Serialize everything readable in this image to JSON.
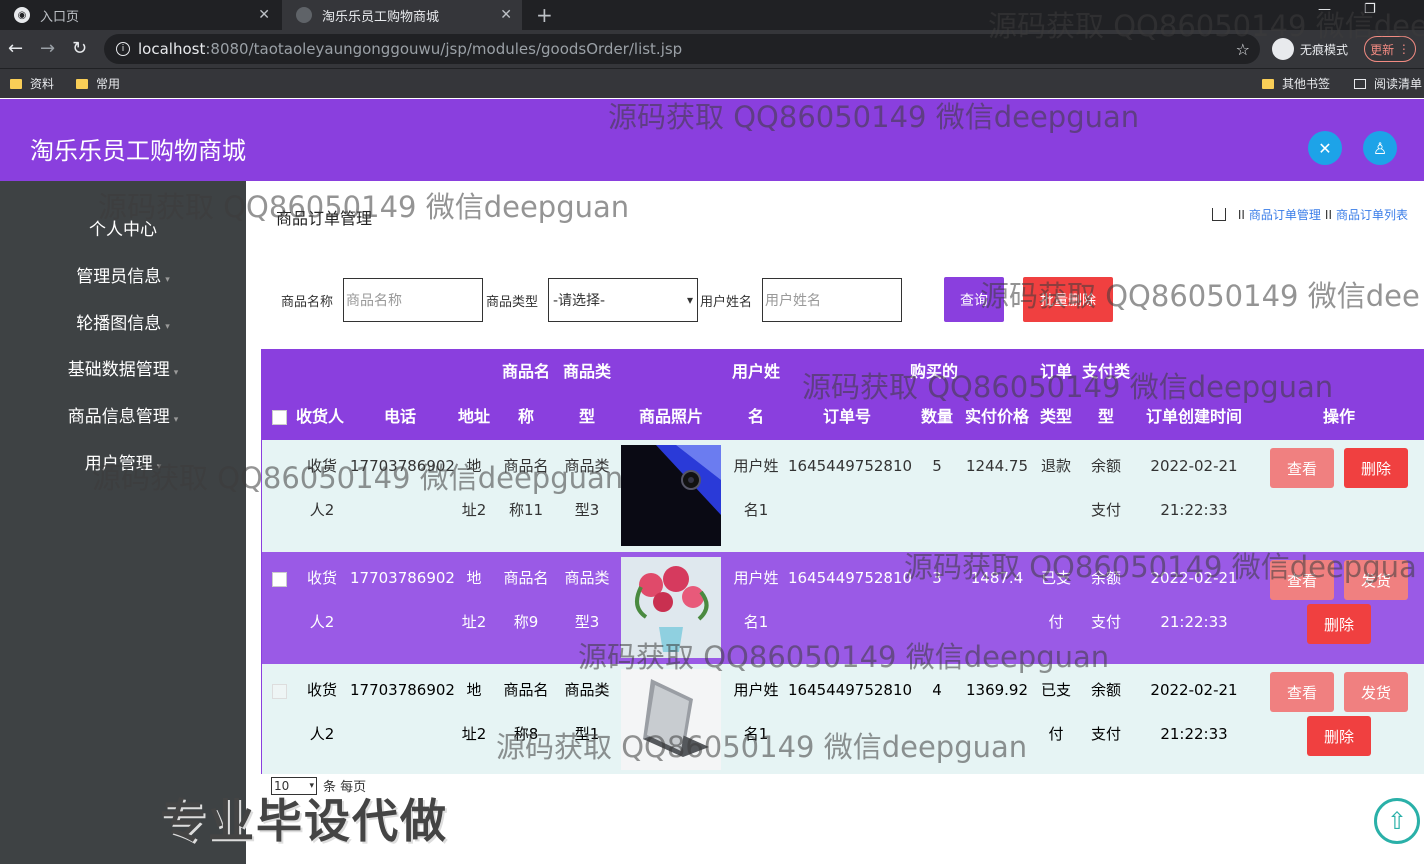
{
  "browser": {
    "tabs": [
      {
        "label": "入口页"
      },
      {
        "label": "淘乐乐员工购物商城"
      }
    ],
    "url_host": "localhost",
    "url_path": ":8080/taotaoleyaungonggouwu/jsp/modules/goodsOrder/list.jsp",
    "incognito_label": "无痕模式",
    "update_label": "更新",
    "bookmarks": {
      "left": [
        "资料",
        "常用"
      ],
      "right": [
        "其他书签",
        "阅读清单"
      ]
    }
  },
  "header": {
    "brand": "淘乐乐员工购物商城"
  },
  "sidebar": {
    "items": [
      {
        "label": "个人中心"
      },
      {
        "label": "管理员信息"
      },
      {
        "label": "轮播图信息"
      },
      {
        "label": "基础数据管理"
      },
      {
        "label": "商品信息管理"
      },
      {
        "label": "用户管理"
      }
    ]
  },
  "page": {
    "title": "商品订单管理",
    "breadcrumb": [
      "商品订单管理",
      "商品订单列表"
    ]
  },
  "filters": {
    "goods_name_label": "商品名称",
    "goods_name_placeholder": "商品名称",
    "goods_type_label": "商品类型",
    "goods_type_value": "-请选择-",
    "user_name_label": "用户姓名",
    "user_name_placeholder": "用户姓名",
    "query_label": "查询",
    "batch_delete_label": "批量删除"
  },
  "table": {
    "headers": {
      "receiver": "收货人",
      "phone": "电话",
      "address": "地址",
      "goods_name": [
        "商品名",
        "称"
      ],
      "goods_type": [
        "商品类",
        "型"
      ],
      "photo": "商品照片",
      "user": [
        "用户姓",
        "名"
      ],
      "order_no": "订单号",
      "qty": "数量",
      "price": "实付价格",
      "order_type": [
        "订单",
        "类型"
      ],
      "pay_type": [
        "支付类",
        "型"
      ],
      "created": "订单创建时间",
      "action": "操作",
      "buy_top": "购买的"
    },
    "rows": [
      {
        "receiver": [
          "收货",
          "人2"
        ],
        "phone": "17703786902",
        "address": [
          "地",
          "址2"
        ],
        "goods_name": [
          "商品名",
          "称11"
        ],
        "goods_type": [
          "商品类",
          "型3"
        ],
        "user": [
          "用户姓",
          "名1"
        ],
        "order_no": "1645449752810",
        "qty": "5",
        "price": "1244.75",
        "order_type": [
          "退款",
          ""
        ],
        "pay_type": [
          "余额",
          "支付"
        ],
        "created": [
          "2022-02-21",
          "21:22:33"
        ],
        "actions": [
          "查看",
          "删除"
        ]
      },
      {
        "receiver": [
          "收货",
          "人2"
        ],
        "phone": "17703786902",
        "address": [
          "地",
          "址2"
        ],
        "goods_name": [
          "商品名",
          "称9"
        ],
        "goods_type": [
          "商品类",
          "型3"
        ],
        "user": [
          "用户姓",
          "名1"
        ],
        "order_no": "1645449752810",
        "qty": "3",
        "price": "1487.4",
        "order_type": [
          "已支",
          "付"
        ],
        "pay_type": [
          "余额",
          "支付"
        ],
        "created": [
          "2022-02-21",
          "21:22:33"
        ],
        "actions": [
          "查看",
          "发货",
          "删除"
        ]
      },
      {
        "receiver": [
          "收货",
          "人2"
        ],
        "phone": "17703786902",
        "address": [
          "地",
          "址2"
        ],
        "goods_name": [
          "商品名",
          "称8"
        ],
        "goods_type": [
          "商品类",
          "型1"
        ],
        "user": [
          "用户姓",
          "名1"
        ],
        "order_no": "1645449752810",
        "qty": "4",
        "price": "1369.92",
        "order_type": [
          "已支",
          "付"
        ],
        "pay_type": [
          "余额",
          "支付"
        ],
        "created": [
          "2022-02-21",
          "21:22:33"
        ],
        "actions": [
          "查看",
          "发货",
          "删除"
        ]
      }
    ]
  },
  "pager": {
    "page_size": "10",
    "suffix": "条 每页"
  },
  "watermark": "源码获取 QQ86050149 微信deepguan",
  "watermark_cut": "源码获取 QQ86050149 微信dee",
  "watermark_cut2": "源码获取 QQ86050149 微信deepgua",
  "big_watermark": "专业毕设代做"
}
